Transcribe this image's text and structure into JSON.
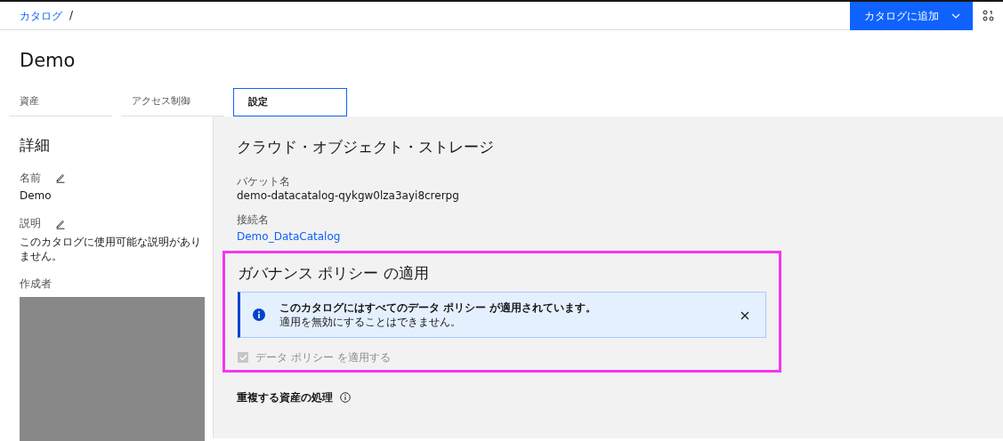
{
  "breadcrumb": [
    {
      "label": "カタログ"
    }
  ],
  "breadcrumb_separator": "/",
  "header_actions": {
    "primary_button": "カタログに追加"
  },
  "page_title": "Demo",
  "tabs": [
    {
      "label": "資産",
      "selected": false
    },
    {
      "label": "アクセス制御",
      "selected": false
    },
    {
      "label": "設定",
      "selected": true
    }
  ],
  "details": {
    "title": "詳細",
    "fields": [
      {
        "label": "名前",
        "editable": true,
        "value": "Demo"
      },
      {
        "label": "説明",
        "editable": true,
        "value": "このカタログに使用可能な説明がありません。"
      },
      {
        "label": "作成者",
        "editable": false,
        "redacted": true
      }
    ]
  },
  "storage": {
    "title": "クラウド・オブジェクト・ストレージ",
    "fields": [
      {
        "label": "バケット名",
        "value": "demo-datacatalog-qykgw0lza3ayi8crerpg",
        "kind": "text"
      },
      {
        "label": "接続名",
        "value": "Demo_DataCatalog",
        "kind": "link"
      }
    ]
  },
  "governance": {
    "title": "ガバナンス ポリシー の適用",
    "highlighted": true,
    "notification": {
      "title": "このカタログにはすべてのデータ ポリシー が適用されています。",
      "message": "適用を無効にすることはできません。"
    },
    "checkbox": {
      "label": "データ ポリシー を適用する",
      "checked": true,
      "disabled": true
    }
  },
  "duplicates": {
    "title": "重複する資産の処理"
  }
}
